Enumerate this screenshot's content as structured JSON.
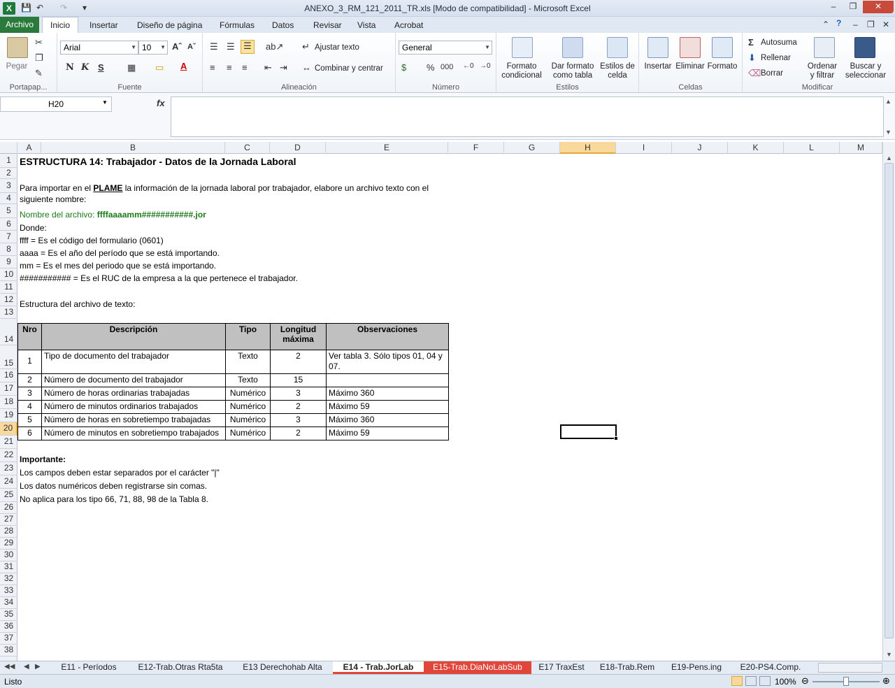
{
  "window": {
    "title": "ANEXO_3_RM_121_2011_TR.xls  [Modo de compatibilidad]  -  Microsoft Excel",
    "logo": "X"
  },
  "tabs": [
    "Archivo",
    "Inicio",
    "Insertar",
    "Diseño de página",
    "Fórmulas",
    "Datos",
    "Revisar",
    "Vista",
    "Acrobat"
  ],
  "ribbon": {
    "portapapeles": {
      "paste": "Pegar",
      "label": "Portapap..."
    },
    "fuente": {
      "font": "Arial",
      "size": "10",
      "bold": "N",
      "italic": "K",
      "underline": "S",
      "label": "Fuente"
    },
    "alineacion": {
      "wrap": "Ajustar texto",
      "merge": "Combinar y centrar",
      "label": "Alineación"
    },
    "numero": {
      "format": "General",
      "percent": "%",
      "thousands": "000",
      "label": "Número"
    },
    "estilos": {
      "cond": "Formato\ncondicional",
      "table": "Dar formato\ncomo tabla",
      "cell": "Estilos de\ncelda",
      "label": "Estilos"
    },
    "celdas": {
      "insert": "Insertar",
      "delete": "Eliminar",
      "format": "Formato",
      "label": "Celdas"
    },
    "modificar": {
      "autosum": "Autosuma",
      "fill": "Rellenar",
      "clear": "Borrar",
      "sort": "Ordenar\ny filtrar",
      "find": "Buscar y\nseleccionar",
      "label": "Modificar"
    }
  },
  "namebox": "H20",
  "fx": "fx",
  "columns": [
    "A",
    "B",
    "C",
    "D",
    "E",
    "F",
    "G",
    "H",
    "I",
    "J",
    "K",
    "L",
    "M"
  ],
  "rows": [
    "1",
    "2",
    "3",
    "4",
    "5",
    "6",
    "7",
    "8",
    "9",
    "10",
    "11",
    "12",
    "13",
    "14",
    "15",
    "16",
    "17",
    "18",
    "19",
    "20",
    "21",
    "22",
    "23",
    "24",
    "25",
    "26",
    "27",
    "28",
    "29",
    "30",
    "31",
    "32",
    "33",
    "34",
    "35",
    "36",
    "37",
    "38"
  ],
  "sheet": {
    "title": "ESTRUCTURA 14:  Trabajador - Datos de la Jornada Laboral",
    "intro_a": "Para importar en el ",
    "intro_plame": "PLAME",
    "intro_b": " la información de la jornada laboral por trabajador, elabore un archivo texto con el",
    "intro_c": "siguiente nombre:",
    "filename_label": "Nombre del archivo: ",
    "filename_value": "ffffaaaamm###########.jor",
    "donde": "Donde:",
    "l7": "ffff = Es el código del formulario (0601)",
    "l8": "aaaa = Es el año del período que se está importando.",
    "l9": "mm = Es el mes del periodo que se está importando.",
    "l10": "########### = Es el RUC de la empresa a la que pertenece el trabajador.",
    "l12": "Estructura del archivo de texto:",
    "headers": {
      "nro": "Nro",
      "desc": "Descripción",
      "tipo": "Tipo",
      "long1": "Longitud",
      "long2": "máxima",
      "obs": "Observaciones"
    },
    "table": [
      {
        "nro": "1",
        "desc": "Tipo de documento del trabajador",
        "tipo": "Texto",
        "long": "2",
        "obs1": "Ver tabla 3. Sólo tipos 01, 04 y",
        "obs2": "07."
      },
      {
        "nro": "2",
        "desc": "Número de documento del trabajador",
        "tipo": "Texto",
        "long": "15",
        "obs1": "",
        "obs2": ""
      },
      {
        "nro": "3",
        "desc": "Número de horas ordinarias trabajadas",
        "tipo": "Numérico",
        "long": "3",
        "obs1": "Máximo 360",
        "obs2": ""
      },
      {
        "nro": "4",
        "desc": "Número de minutos ordinarios trabajados",
        "tipo": "Numérico",
        "long": "2",
        "obs1": "Máximo 59",
        "obs2": ""
      },
      {
        "nro": "5",
        "desc": "Número de horas en sobretiempo trabajadas",
        "tipo": "Numérico",
        "long": "3",
        "obs1": "Máximo 360",
        "obs2": ""
      },
      {
        "nro": "6",
        "desc": "Número de minutos en sobretiempo trabajados",
        "tipo": "Numérico",
        "long": "2",
        "obs1": "Máximo 59",
        "obs2": ""
      }
    ],
    "importante": "Importante:",
    "l23": "Los campos deben estar separados por el carácter \"|\"",
    "l24": "Los datos numéricos deben registrarse sin comas.",
    "l25": "No aplica para los tipo 66, 71, 88, 98 de la Tabla 8."
  },
  "sheet_tabs": [
    "E11 - Períodos",
    "E12-Trab.Otras Rta5ta",
    "E13 Derechohab Alta",
    "E14 - Trab.JorLab",
    "E15-Trab.DiaNoLabSub",
    "E17 TraxEst",
    "E18-Trab.Rem",
    "E19-Pens.ing",
    "E20-PS4.Comp."
  ],
  "status": {
    "ready": "Listo",
    "zoom": "100%"
  },
  "colors": {
    "green_text": "#1a7a1a",
    "header_fill": "#c0c0c0",
    "active_tab_red": "#e0463a"
  }
}
